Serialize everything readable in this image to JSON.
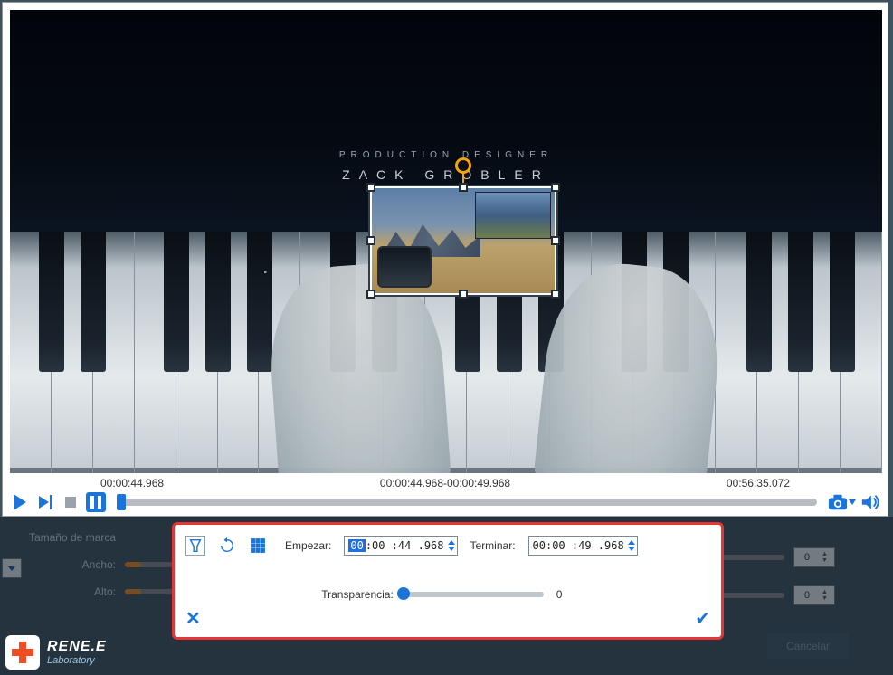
{
  "credit": {
    "role": "PRODUCTION DESIGNER",
    "name": "ZACK  GROBLER"
  },
  "timeline": {
    "current": "00:00:44.968",
    "range": "00:00:44.968-00:00:49.968",
    "duration": "00:56:35.072"
  },
  "sizing": {
    "marker_label": "Tamaño de marca",
    "width_label": "Ancho:",
    "height_label": "Alto:",
    "right_value_1": "0",
    "right_value_2": "0"
  },
  "popup": {
    "start_label": "Empezar:",
    "start_value": {
      "hh": "00",
      "rest": " :00 :44 .968"
    },
    "end_label": "Terminar:",
    "end_value": {
      "hh": "00",
      "rest": " :00 :49 .968"
    },
    "transparency_label": "Transparencia:",
    "transparency_value": "0"
  },
  "buttons": {
    "cancel": "Cancelar"
  },
  "brand": {
    "line1": "RENE.E",
    "line2": "Laboratory"
  }
}
